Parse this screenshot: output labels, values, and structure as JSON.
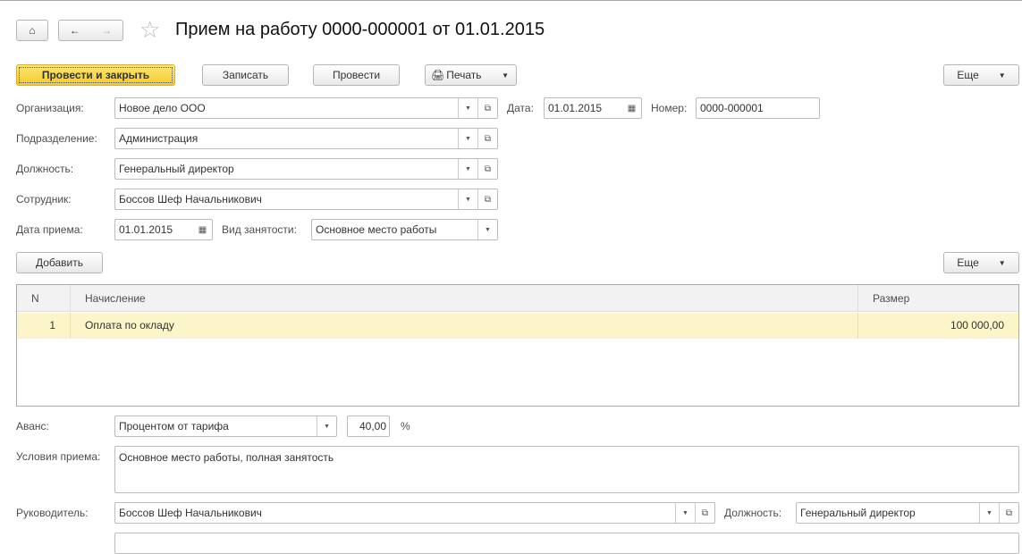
{
  "header": {
    "title": "Прием на работу 0000-000001 от 01.01.2015"
  },
  "toolbar": {
    "post_close": "Провести и закрыть",
    "save": "Записать",
    "post": "Провести",
    "print": "Печать",
    "more": "Еще"
  },
  "form": {
    "organization": {
      "label": "Организация:",
      "value": "Новое дело ООО"
    },
    "date": {
      "label": "Дата:",
      "value": "01.01.2015"
    },
    "number": {
      "label": "Номер:",
      "value": "0000-000001"
    },
    "department": {
      "label": "Подразделение:",
      "value": "Администрация"
    },
    "position": {
      "label": "Должность:",
      "value": "Генеральный директор"
    },
    "employee": {
      "label": "Сотрудник:",
      "value": "Боссов Шеф Начальникович"
    },
    "hire_date": {
      "label": "Дата приема:",
      "value": "01.01.2015"
    },
    "employment_type": {
      "label": "Вид занятости:",
      "value": "Основное место работы"
    },
    "advance": {
      "label": "Аванс:",
      "value": "Процентом от тарифа",
      "amount": "40,00",
      "unit": "%"
    },
    "conditions": {
      "label": "Условия приема:",
      "value": "Основное место работы, полная занятость"
    },
    "manager": {
      "label": "Руководитель:",
      "value": "Боссов Шеф Начальникович"
    },
    "manager_position": {
      "label": "Должность:",
      "value": "Генеральный директор"
    }
  },
  "table_toolbar": {
    "add": "Добавить",
    "more": "Еще"
  },
  "table": {
    "columns": [
      "N",
      "Начисление",
      "Размер"
    ],
    "rows": [
      {
        "n": "1",
        "accrual": "Оплата по окладу",
        "amount": "100 000,00"
      }
    ]
  }
}
